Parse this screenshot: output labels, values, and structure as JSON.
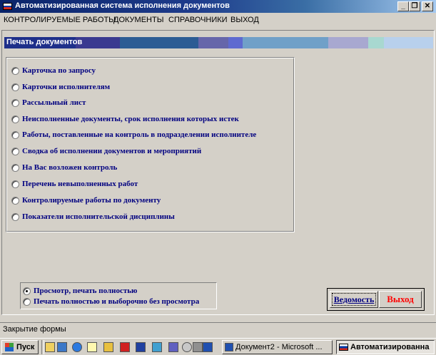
{
  "window": {
    "title": "Автоматизированная система исполнения документов",
    "controls": {
      "minimize": "_",
      "restore": "❐",
      "close": "✕"
    },
    "flag_colors": [
      "#ffffff",
      "#0039a6",
      "#d52b1e"
    ]
  },
  "menu": {
    "items": [
      "КОНТРОЛИРУЕМЫЕ РАБОТЫ",
      "ДОКУМЕНТЫ",
      "СПРАВОЧНИКИ",
      "ВЫХОД"
    ]
  },
  "panel": {
    "title": "Печать документов",
    "bar_colors": [
      "#3a3a90",
      "#3a3a90",
      "#6666aa",
      "#5e6aa8",
      "#70a0c8",
      "#a8a8d0",
      "#c0e0e0",
      "#c8d8f0"
    ]
  },
  "reports": [
    "Карточка по запросу",
    "Карточки исполнителям",
    "Рассыльный лист",
    "Неисполненные документы, срок исполнения которых истек",
    "Работы, поставленные на контроль в подразделении исполнителе",
    "Сводка об исполнении документов и мероприятий",
    "На Вас возложен контроль",
    "Перечень невыполненных работ",
    "Контролируемые работы по документу",
    "Показатели исполнительской дисциплины"
  ],
  "print_mode": {
    "options": [
      {
        "label": "Просмотр, печать полностью",
        "checked": true
      },
      {
        "label": "Печать полностью и выборочно без просмотра",
        "checked": false
      }
    ]
  },
  "buttons": {
    "vedomost": "Ведомость",
    "exit": "Выход",
    "exit_color": "#ff0000"
  },
  "status": {
    "text": "Закрытие формы"
  },
  "taskbar": {
    "start_label": "Пуск",
    "quick_icons": [
      "explorer-icon",
      "desktop-icon",
      "ie-icon",
      "notepad-icon",
      "pen-icon",
      "acrobat-icon",
      "books-icon",
      "edit-icon",
      "save-icon",
      "disk-icon",
      "gear-icon",
      "word-icon"
    ],
    "tasks": [
      {
        "label": "Документ2 - Microsoft ...",
        "active": false
      },
      {
        "label": "Автоматизированна",
        "active": true
      }
    ]
  }
}
